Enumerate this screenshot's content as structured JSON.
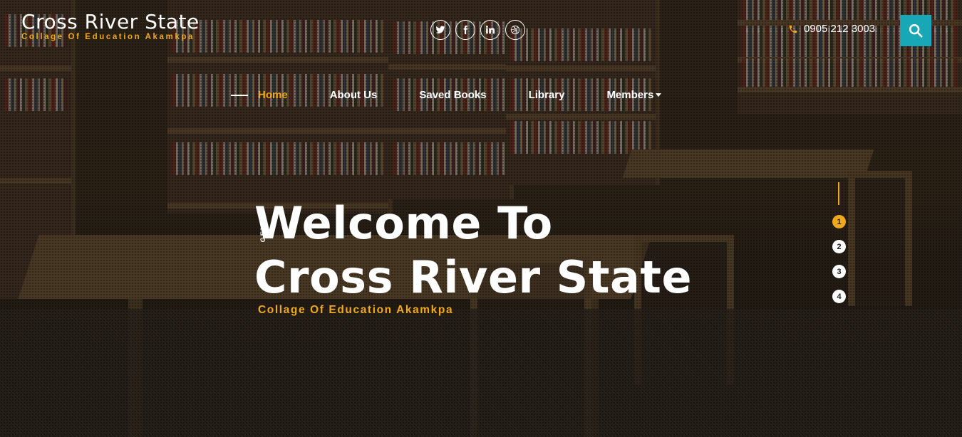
{
  "brand": {
    "title": "Cross River State",
    "subtitle": "Collage Of Education Akamkpa"
  },
  "social": [
    {
      "name": "twitter-icon"
    },
    {
      "name": "facebook-icon"
    },
    {
      "name": "linkedin-icon"
    },
    {
      "name": "dribbble-icon"
    }
  ],
  "contact": {
    "phone": "0905 212 3003"
  },
  "nav": {
    "items": [
      {
        "label": "Home",
        "active": true
      },
      {
        "label": "About Us"
      },
      {
        "label": "Saved Books"
      },
      {
        "label": "Library"
      },
      {
        "label": "Members",
        "dropdown": true
      }
    ]
  },
  "hero": {
    "tag": "GENIUS",
    "title_line1": "Welcome To",
    "title_line2": "Cross River State",
    "subtitle": "Collage Of Education Akamkpa"
  },
  "pager": {
    "pages": [
      "1",
      "2",
      "3",
      "4"
    ],
    "active_index": 0
  },
  "colors": {
    "accent": "#f0a81e",
    "search": "#18a7b5"
  }
}
